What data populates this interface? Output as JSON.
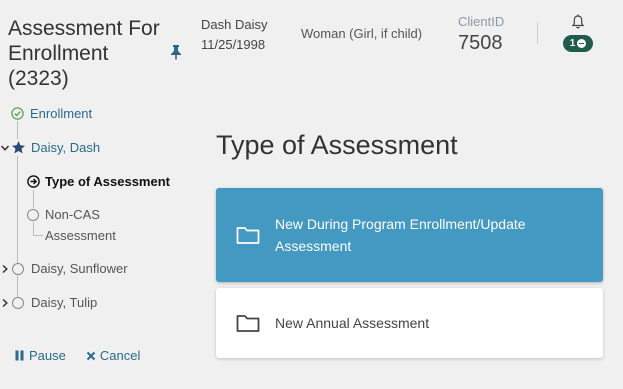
{
  "sidebar": {
    "title": "Assessment For Enrollment (2323)",
    "steps": [
      {
        "label": "Enrollment",
        "state": "complete"
      },
      {
        "label": "Daisy, Dash",
        "state": "expanded-primary"
      },
      {
        "label": "Type of Assessment",
        "state": "current"
      },
      {
        "label": "Non-CAS Assessment",
        "state": "pending"
      },
      {
        "label": "Daisy, Sunflower",
        "state": "collapsed"
      },
      {
        "label": "Daisy, Tulip",
        "state": "collapsed"
      }
    ],
    "pause_label": "Pause",
    "cancel_label": "Cancel"
  },
  "header": {
    "client_name": "Dash Daisy",
    "dob": "11/25/1998",
    "gender": "Woman (Girl, if child)",
    "client_id_label": "ClientID",
    "client_id": "7508",
    "notification_count": "1"
  },
  "main": {
    "heading": "Type of Assessment",
    "options": [
      {
        "label": "New During Program Enrollment/Update Assessment",
        "selected": true
      },
      {
        "label": "New Annual Assessment",
        "selected": false
      }
    ]
  },
  "colors": {
    "selected_option": "#4399c2",
    "badge": "#1f5c4a",
    "action_link": "#2a6a8c",
    "complete_check": "#5aa55a"
  }
}
